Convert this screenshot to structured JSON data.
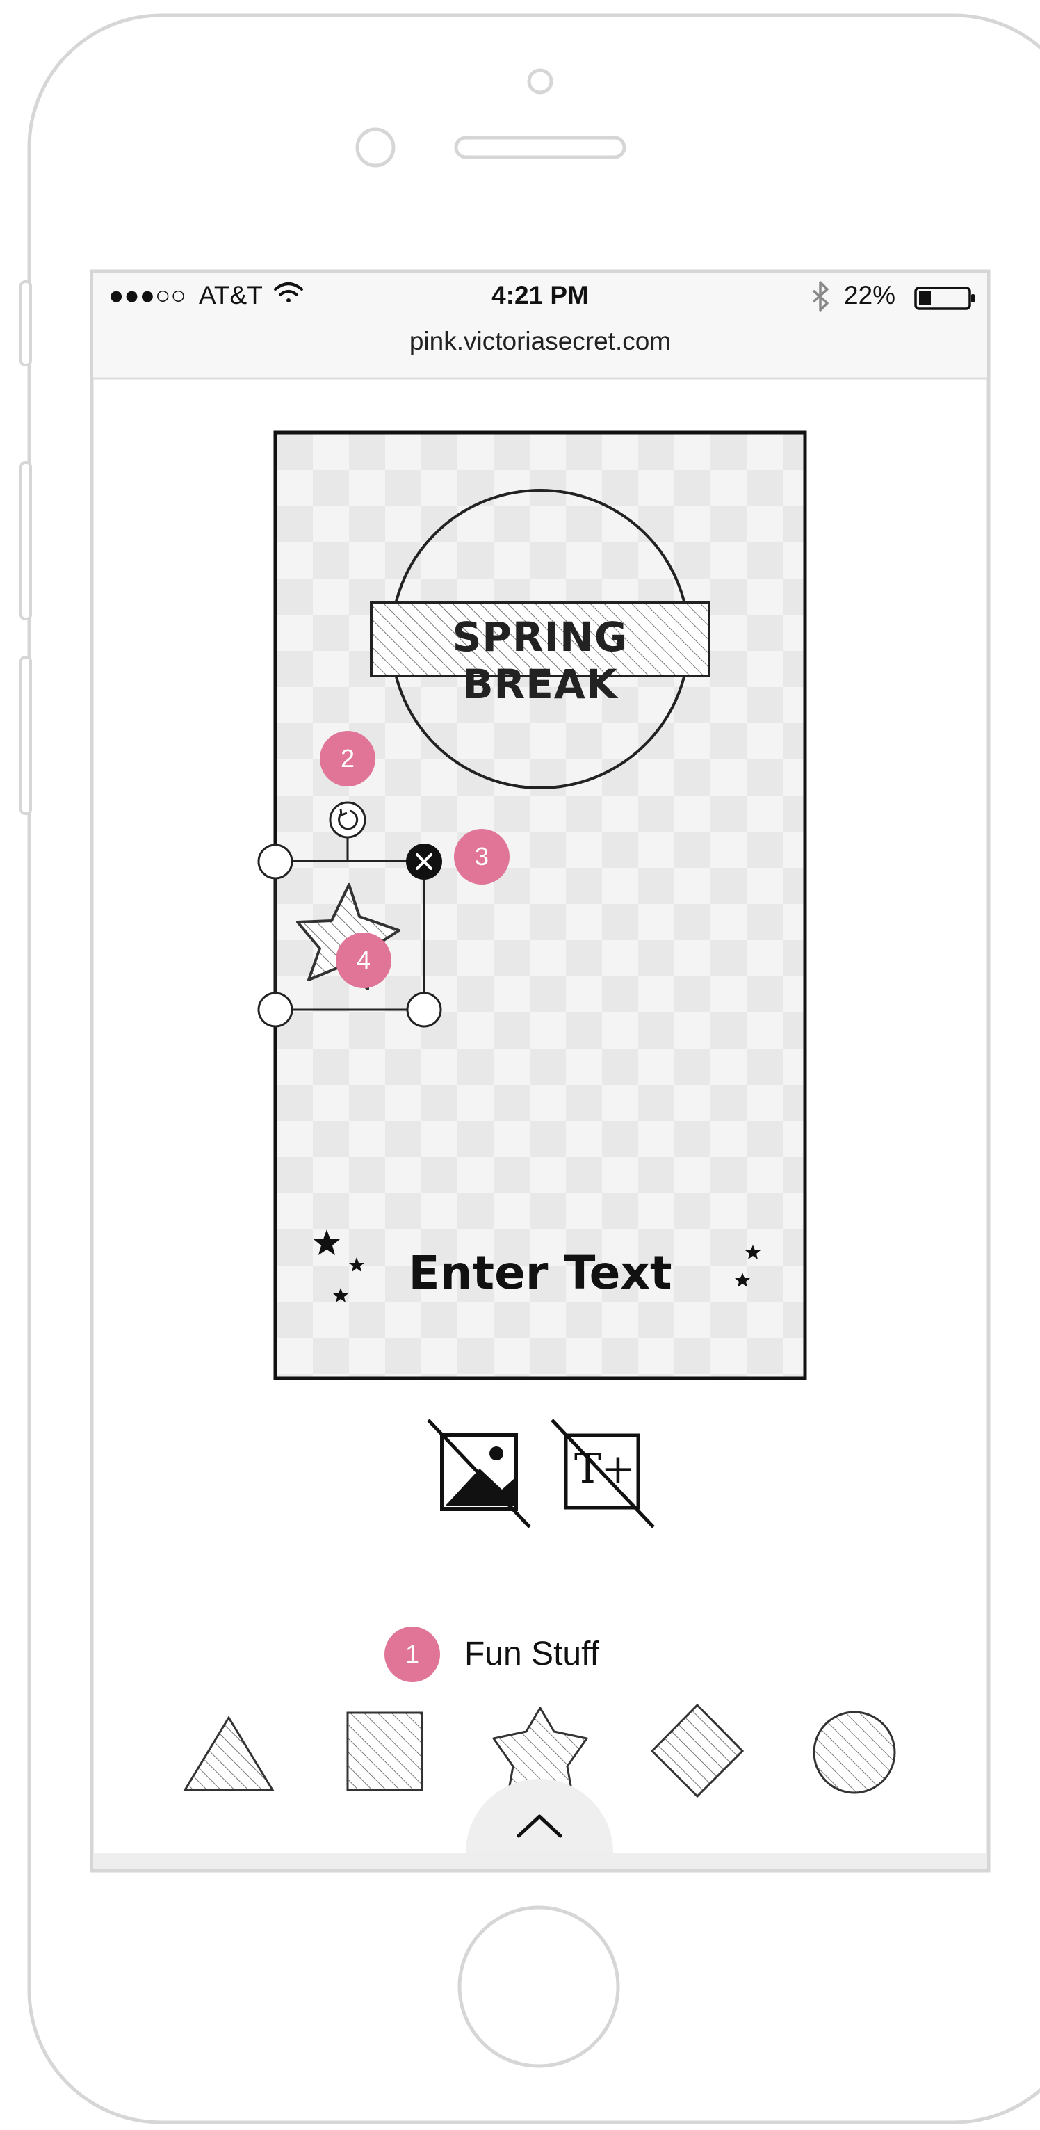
{
  "status_bar": {
    "signal": "●●●○○",
    "carrier": "AT&T",
    "time": "4:21 PM",
    "bluetooth_icon": "bluetooth-icon",
    "battery": "22%"
  },
  "browser": {
    "url": "pink.victoriasecret.com"
  },
  "canvas": {
    "banner_text": "SPRING BREAK",
    "enter_text": "Enter Text"
  },
  "markers": {
    "m1": "1",
    "m2": "2",
    "m3": "3",
    "m4": "4"
  },
  "tools": {
    "add_image_icon": "image-icon",
    "add_text_icon": "text-plus-icon",
    "text_tool_glyph": "T+"
  },
  "fun_stuff": {
    "label": "Fun Stuff",
    "shapes": [
      "triangle",
      "square",
      "star",
      "diamond",
      "circle"
    ]
  },
  "colors": {
    "marker": "#e07597",
    "checker_light": "#f2f2f2",
    "checker_dark": "#e6e6e6"
  }
}
